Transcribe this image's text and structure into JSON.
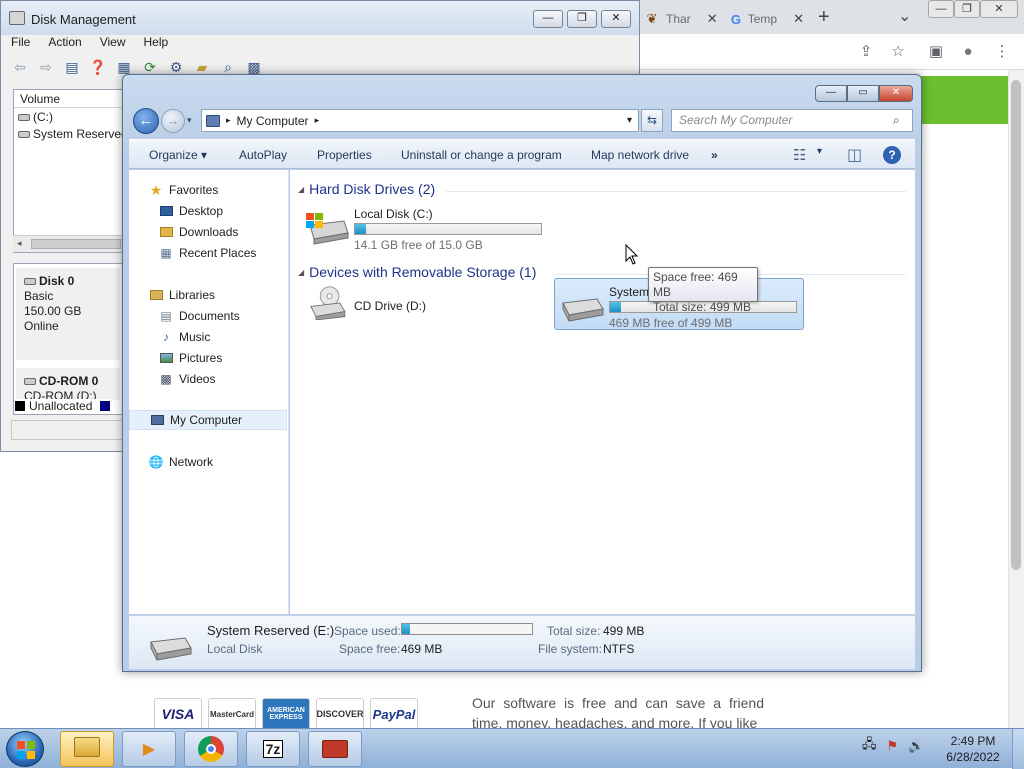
{
  "browser": {
    "tabs": [
      {
        "label": "Thar",
        "icon": "bear-icon"
      },
      {
        "label": "Temp",
        "icon": "google-icon"
      }
    ],
    "new_tab_glyph": "+",
    "dropdown_glyph": "⌄",
    "win_controls": {
      "minimize": "—",
      "restore": "❐",
      "close": "✕"
    },
    "toolbar_icons": {
      "share": "⇪",
      "star": "☆",
      "sidebar": "▣",
      "profile": "●",
      "menu": "⋮"
    },
    "web_text": "Our software is free and can save a friend time, money, headaches, and more. If you like",
    "payment_logos": [
      "VISA",
      "MasterCard",
      "AMERICAN EXPRESS",
      "DISCOVER",
      "PayPal"
    ],
    "banner_color": "#6cbf2f"
  },
  "disk_management": {
    "title": "Disk Management",
    "menu": [
      "File",
      "Action",
      "View",
      "Help"
    ],
    "controls": {
      "minimize": "—",
      "restore": "❐",
      "close": "✕"
    },
    "volume_header": "Volume",
    "volumes": [
      "(C:)",
      "System Reserved"
    ],
    "disks": [
      {
        "name": "Disk 0",
        "type": "Basic",
        "size": "150.00 GB",
        "status": "Online"
      },
      {
        "name": "CD-ROM 0",
        "sub": "CD-ROM (D:)"
      }
    ],
    "legend": {
      "label": "Unallocated",
      "color": "#000000",
      "primary_color": "#000080"
    }
  },
  "explorer": {
    "controls": {
      "minimize": "—",
      "maximize": "▭",
      "close": "✕"
    },
    "nav": {
      "back": "←",
      "forward": "→",
      "history": "▾"
    },
    "address": {
      "location": "My Computer",
      "separator": "▸",
      "dropdown": "▾",
      "refresh": "⇆"
    },
    "search": {
      "placeholder": "Search My Computer",
      "icon": "⌕"
    },
    "commands": [
      "Organize ▾",
      "AutoPlay",
      "Properties",
      "Uninstall or change a program",
      "Map network drive",
      "»"
    ],
    "view_icons": {
      "views": "☷",
      "views_dropdown": "▾",
      "preview": "◫",
      "help": "?"
    },
    "nav_pane": {
      "favorites": "Favorites",
      "favorites_items": [
        "Desktop",
        "Downloads",
        "Recent Places"
      ],
      "libraries": "Libraries",
      "libraries_items": [
        "Documents",
        "Music",
        "Pictures",
        "Videos"
      ],
      "computer": "My Computer",
      "network": "Network"
    },
    "groups": {
      "hdd": {
        "title": "Hard Disk Drives (2)",
        "arrow": "◢"
      },
      "removable": {
        "title": "Devices with Removable Storage (1)",
        "arrow": "◢"
      }
    },
    "drives": [
      {
        "name": "Local Disk (C:)",
        "free_text": "14.1 GB free of 15.0 GB",
        "used_fraction": 0.06
      },
      {
        "name": "System Reserved (E:)",
        "free_text": "469 MB free of 499 MB",
        "used_fraction": 0.06
      }
    ],
    "cd_drive": {
      "name": "CD Drive (D:)"
    },
    "tooltip": {
      "line1": "Space free: 469 MB",
      "line2": "Total size: 499 MB"
    },
    "details": {
      "name": "System Reserved (E:)",
      "kind": "Local Disk",
      "space_used_label": "Space used:",
      "used_fraction": 0.06,
      "space_free_label": "Space free:",
      "space_free": "469 MB",
      "total_size_label": "Total size:",
      "total_size": "499 MB",
      "file_system_label": "File system:",
      "file_system": "NTFS"
    }
  },
  "taskbar": {
    "clock_time": "2:49 PM",
    "clock_date": "6/28/2022",
    "app_7zip": "7z",
    "tray": {
      "network": "🖧",
      "flag": "⚑",
      "volume": "🔊"
    }
  }
}
